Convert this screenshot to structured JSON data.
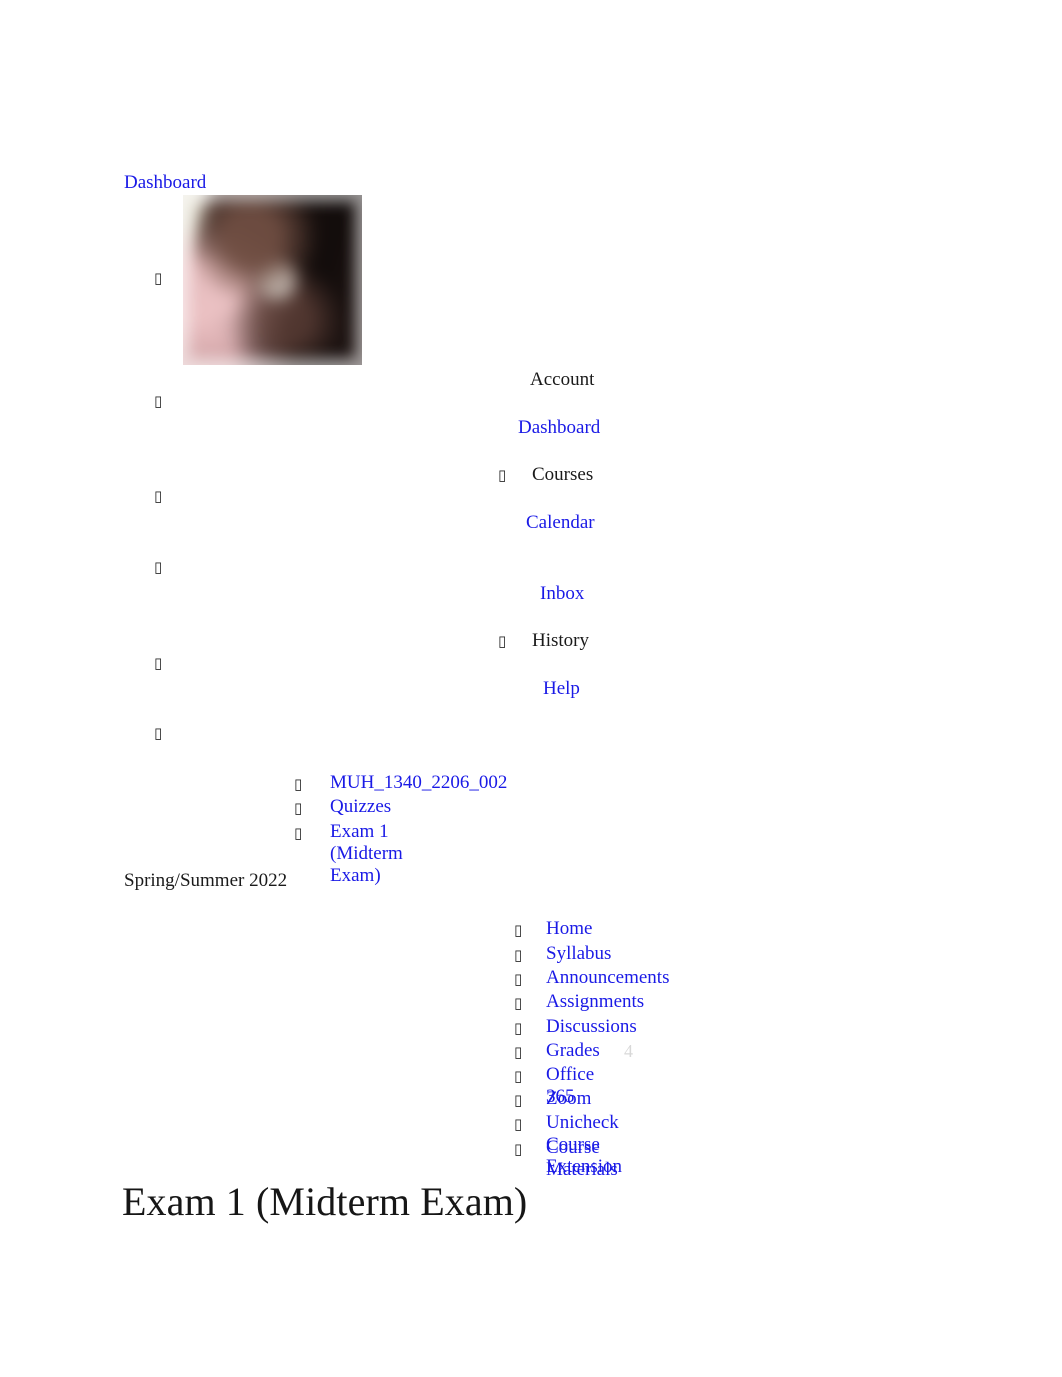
{
  "document": {
    "top_breadcrumb_link": "Dashboard",
    "page_title": "Exam 1 (Midterm Exam)",
    "term": "Spring/Summer 2022"
  },
  "avatar": {
    "icon": "user-avatar-photo"
  },
  "global_nav": {
    "icon_glyph": "missing-glyph-box",
    "items": [
      {
        "label": "Account",
        "type": "plain",
        "has_marker": false
      },
      {
        "label": "Dashboard",
        "type": "link",
        "has_marker": false
      },
      {
        "label": "Courses",
        "type": "plain",
        "has_marker": true
      },
      {
        "label": "Calendar",
        "type": "link",
        "has_marker": false
      },
      {
        "label": "Inbox",
        "type": "link",
        "has_marker": false
      },
      {
        "label": "History",
        "type": "plain",
        "has_marker": true
      },
      {
        "label": "Help",
        "type": "link",
        "has_marker": false
      }
    ]
  },
  "breadcrumb": {
    "items": [
      {
        "label": "MUH_1340_2206_002"
      },
      {
        "label": "Quizzes"
      },
      {
        "label": "Exam 1 (Midterm Exam)"
      }
    ]
  },
  "course_nav": {
    "items": [
      {
        "label": "Home"
      },
      {
        "label": "Syllabus"
      },
      {
        "label": "Announcements"
      },
      {
        "label": "Assignments"
      },
      {
        "label": "Discussions"
      },
      {
        "label": "Grades",
        "badge": "4"
      },
      {
        "label": "Office 365"
      },
      {
        "label": "Zoom"
      },
      {
        "label": "Unicheck Course Extension"
      },
      {
        "label": "Course Materials"
      }
    ]
  },
  "colors": {
    "link": "#1a1ae6",
    "text": "#1a1a1a",
    "background": "#ffffff",
    "badge": "#d8d8d8"
  }
}
